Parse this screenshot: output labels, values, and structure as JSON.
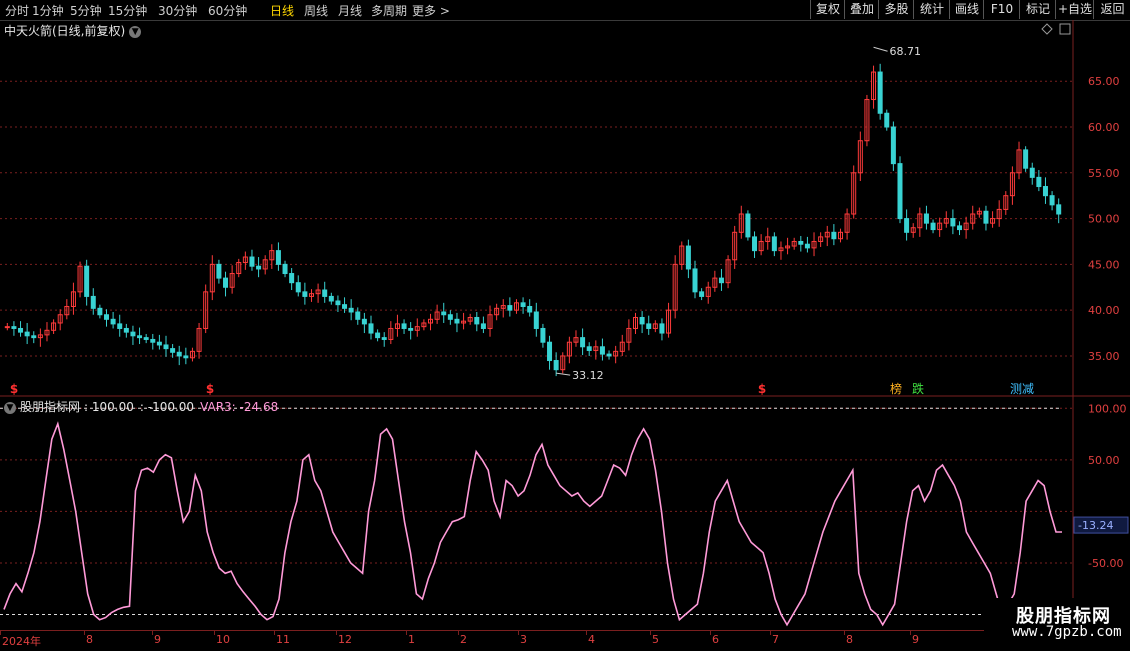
{
  "toolbar": {
    "periods": [
      "分时",
      "1分钟",
      "5分钟",
      "15分钟",
      "30分钟",
      "60分钟",
      "日线",
      "周线",
      "月线",
      "多周期",
      "更多 >"
    ],
    "active_period": "日线",
    "right_buttons": [
      "复权",
      "叠加",
      "多股",
      "统计",
      "画线",
      "F10",
      "标记",
      "+自选",
      "返回"
    ]
  },
  "main_chart": {
    "title": "中天火箭(日线,前复权)",
    "high_label": "68.71",
    "low_label": "33.12",
    "price_ticks": [
      "65.00",
      "60.00",
      "55.00",
      "50.00",
      "45.00",
      "40.00",
      "35.00"
    ],
    "markers": [
      "$",
      "$",
      "$"
    ],
    "tag_labels": [
      "榜",
      "跌",
      "测减"
    ]
  },
  "indicator": {
    "name": "股朋指标网",
    "line1": ": 100.00",
    "line2": ": -100.00",
    "var_label": "VAR3: -24.68",
    "ticks": [
      "100.00",
      "50.00",
      "-50.00"
    ],
    "current_value": "-13.24"
  },
  "date_axis": {
    "labels": [
      "2024年",
      "8",
      "9",
      "10",
      "11",
      "12",
      "1",
      "2",
      "3",
      "4",
      "5",
      "6",
      "7",
      "8",
      "9"
    ]
  },
  "watermark": {
    "title": "股朋指标网",
    "url": "www.7gpzb.com"
  },
  "colors": {
    "up": "#ff3b3b",
    "down": "#39d3d3",
    "indicator_line": "#ff9ad8",
    "grid": "#7a1f1f",
    "axis_text": "#e04040"
  },
  "chart_data": {
    "type": "candlestick",
    "price_ylim": [
      31.5,
      69.5
    ],
    "closes": [
      38.2,
      38.0,
      37.6,
      37.2,
      37.0,
      37.3,
      37.8,
      38.6,
      39.5,
      40.4,
      42.0,
      44.8,
      41.5,
      40.2,
      39.5,
      39.0,
      38.5,
      38.0,
      37.6,
      37.2,
      37.0,
      36.8,
      36.5,
      36.2,
      35.8,
      35.4,
      35.0,
      34.8,
      35.5,
      38.0,
      42.0,
      45.0,
      43.5,
      42.5,
      44.0,
      45.2,
      45.8,
      44.8,
      44.5,
      45.5,
      46.5,
      45.0,
      44.0,
      43.0,
      42.0,
      41.5,
      41.8,
      42.2,
      41.5,
      41.0,
      40.6,
      40.2,
      39.8,
      39.0,
      38.5,
      37.5,
      37.0,
      36.8,
      38.0,
      38.5,
      38.0,
      37.8,
      38.2,
      38.6,
      39.0,
      39.8,
      39.5,
      39.0,
      38.6,
      38.8,
      39.2,
      38.5,
      38.0,
      39.5,
      40.2,
      40.5,
      40.0,
      40.8,
      40.4,
      39.8,
      38.0,
      36.5,
      34.5,
      33.5,
      35.0,
      36.5,
      37.0,
      36.0,
      35.6,
      36.0,
      35.2,
      35.0,
      35.5,
      36.5,
      38.0,
      39.2,
      38.5,
      38.0,
      38.5,
      37.5,
      40.0,
      45.0,
      47.0,
      44.5,
      42.0,
      41.5,
      42.5,
      43.5,
      43.0,
      45.5,
      48.5,
      50.5,
      48.0,
      46.5,
      47.5,
      48.0,
      46.5,
      46.8,
      47.0,
      47.5,
      47.2,
      46.8,
      47.5,
      48.0,
      48.5,
      47.8,
      48.5,
      50.5,
      55.0,
      58.5,
      63.0,
      66.0,
      61.5,
      60.0,
      56.0,
      50.0,
      48.5,
      49.0,
      50.5,
      49.5,
      48.8,
      49.5,
      50.0,
      49.2,
      48.8,
      49.5,
      50.5,
      50.8,
      49.5,
      50.0,
      51.0,
      52.5,
      55.0,
      57.5,
      55.5,
      54.5,
      53.5,
      52.5,
      51.5,
      50.5
    ],
    "indicator_values": [
      -95,
      -80,
      -70,
      -78,
      -60,
      -40,
      -10,
      30,
      70,
      85,
      60,
      30,
      0,
      -40,
      -80,
      -100,
      -105,
      -103,
      -98,
      -95,
      -93,
      -92,
      20,
      40,
      42,
      38,
      50,
      55,
      52,
      20,
      -10,
      0,
      35,
      20,
      -20,
      -40,
      -55,
      -60,
      -58,
      -70,
      -78,
      -85,
      -92,
      -100,
      -105,
      -102,
      -85,
      -40,
      -10,
      10,
      50,
      55,
      30,
      20,
      0,
      -20,
      -30,
      -40,
      -50,
      -55,
      -60,
      0,
      30,
      75,
      80,
      70,
      30,
      -10,
      -40,
      -80,
      -85,
      -65,
      -50,
      -30,
      -20,
      -10,
      -8,
      -5,
      30,
      58,
      50,
      40,
      10,
      -5,
      30,
      25,
      15,
      20,
      35,
      55,
      65,
      45,
      35,
      25,
      20,
      15,
      18,
      10,
      5,
      10,
      15,
      30,
      45,
      42,
      35,
      55,
      70,
      80,
      70,
      40,
      0,
      -50,
      -85,
      -105,
      -100,
      -95,
      -90,
      -60,
      -20,
      10,
      20,
      30,
      10,
      -10,
      -20,
      -30,
      -35,
      -40,
      -60,
      -85,
      -100,
      -110,
      -100,
      -90,
      -80,
      -60,
      -40,
      -20,
      -5,
      10,
      20,
      30,
      40,
      -60,
      -80,
      -95,
      -100,
      -110,
      -100,
      -90,
      -50,
      -10,
      20,
      25,
      10,
      20,
      40,
      45,
      35,
      25,
      10,
      -20,
      -30,
      -40,
      -50,
      -60,
      -80,
      -100,
      -90,
      -80,
      -40,
      10,
      20,
      30,
      25,
      0,
      -20,
      -20
    ],
    "indicator_ylim": [
      -115,
      110
    ]
  }
}
